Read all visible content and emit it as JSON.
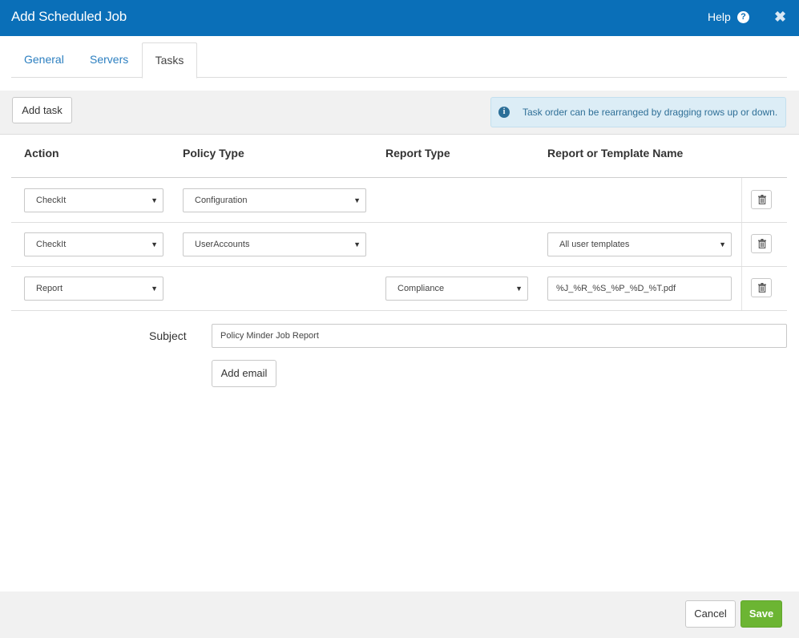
{
  "dialog": {
    "title": "Add Scheduled Job",
    "help_label": "Help",
    "help_icon": "question-circle-icon",
    "close_icon": "close-icon"
  },
  "tabs": [
    {
      "label": "General",
      "active": false
    },
    {
      "label": "Servers",
      "active": false
    },
    {
      "label": "Tasks",
      "active": true
    }
  ],
  "toolbar": {
    "add_task_label": "Add task",
    "info_text": "Task order can be rearranged by dragging rows up or down."
  },
  "table": {
    "headers": [
      "Action",
      "Policy Type",
      "Report Type",
      "Report or Template Name"
    ],
    "rows": [
      {
        "action": "CheckIt",
        "policy_type": "Configuration"
      },
      {
        "action": "CheckIt",
        "policy_type": "UserAccounts",
        "template": "All user templates"
      },
      {
        "action": "Report",
        "report_type": "Compliance",
        "filename": "%J_%R_%S_%P_%D_%T.pdf"
      }
    ]
  },
  "email": {
    "subject_label": "Subject",
    "subject_value": "Policy Minder Job Report",
    "add_email_label": "Add email"
  },
  "footer": {
    "cancel_label": "Cancel",
    "save_label": "Save"
  },
  "colors": {
    "header_bg": "#0a6fb8",
    "tab_link": "#2c7fc0",
    "save_bg": "#6cb533",
    "info_bg": "#dcedf6"
  }
}
